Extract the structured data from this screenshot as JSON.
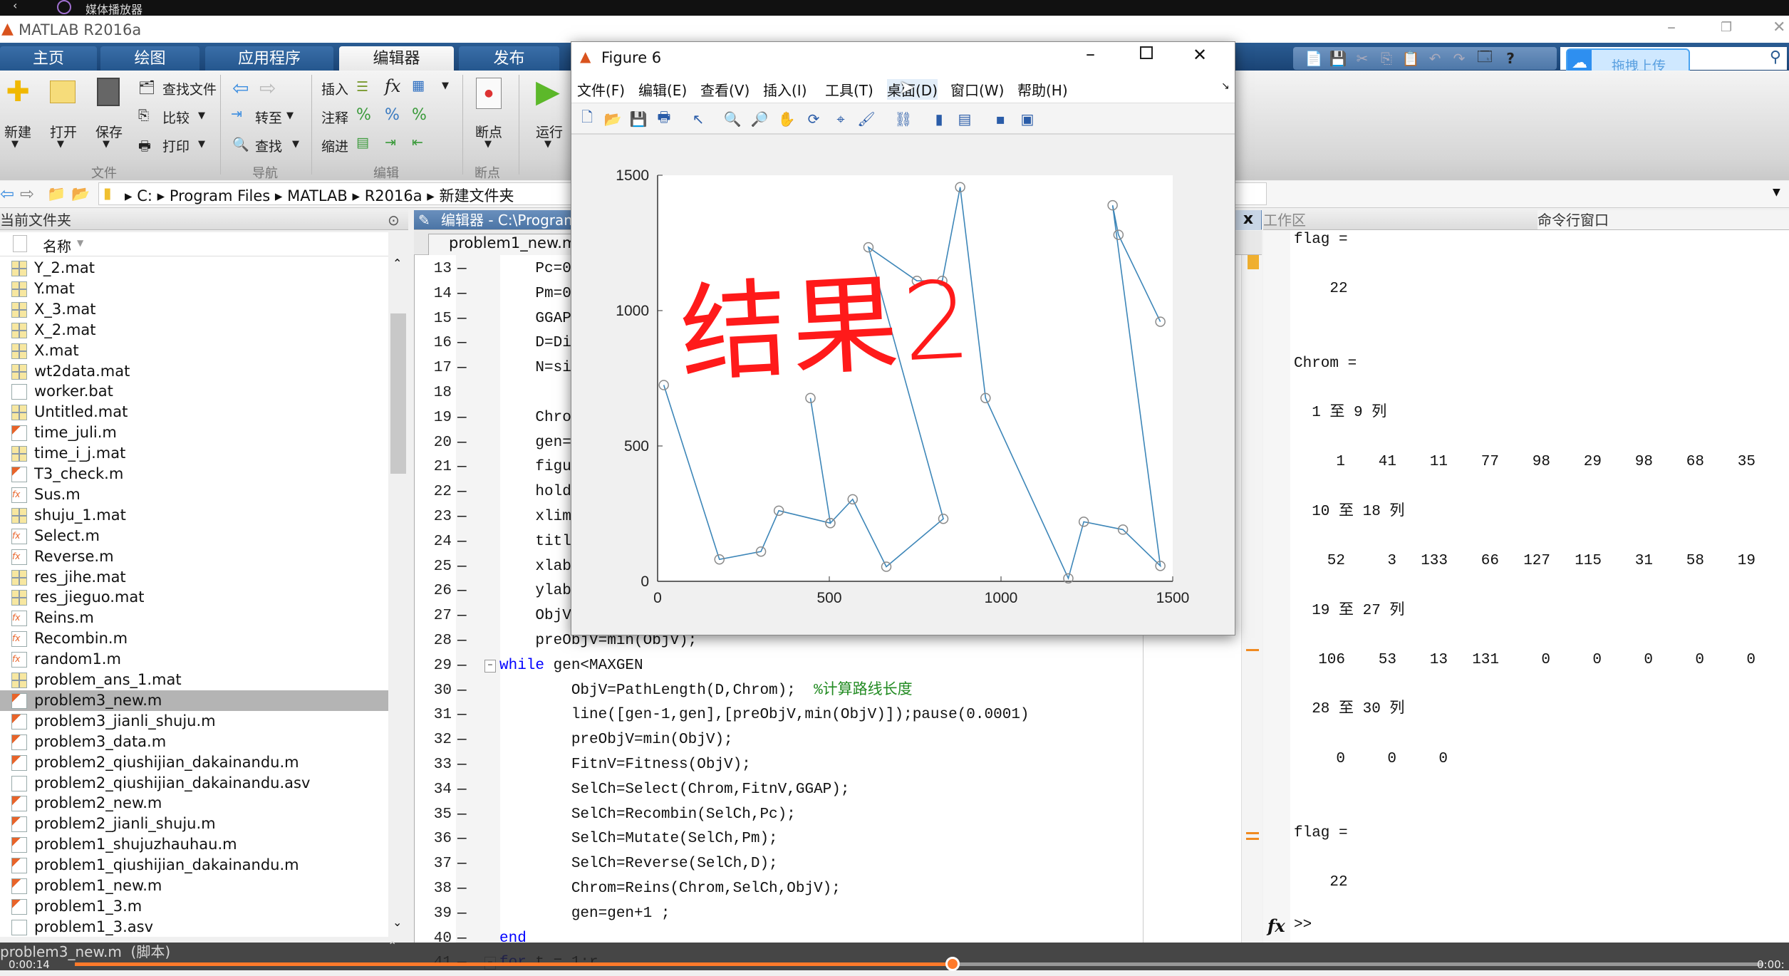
{
  "os": {
    "media_player": "媒体播放器",
    "elapsed": "0:00:14",
    "remaining": "0:00:",
    "progress_percent": 52
  },
  "app": {
    "title": "MATLAB R2016a"
  },
  "tabs": [
    {
      "label": "主页"
    },
    {
      "label": "绘图"
    },
    {
      "label": "应用程序"
    },
    {
      "label": "编辑器",
      "active": true
    },
    {
      "label": "发布"
    }
  ],
  "ribbon": {
    "new": "新建",
    "open": "打开",
    "save": "保存",
    "find_files": "查找文件",
    "compare": "比较",
    "print": "打印",
    "goto": "转至",
    "find": "查找",
    "insert": "插入",
    "comment": "注释",
    "indent": "缩进",
    "fx": "fx",
    "breakpoints": "断点",
    "run": "运行",
    "groups": {
      "file": "文件",
      "nav": "导航",
      "edit": "编辑",
      "bp": "断点"
    }
  },
  "quick_upload": "拖拽上传",
  "address": {
    "parts": [
      "C:",
      "Program Files",
      "MATLAB",
      "R2016a",
      "新建文件夹"
    ]
  },
  "current_folder": {
    "title": "当前文件夹",
    "col_name": "名称",
    "status": "problem3_new.m  (脚本)",
    "files": [
      {
        "name": "Y_2.mat",
        "type": "mat"
      },
      {
        "name": "Y.mat",
        "type": "mat"
      },
      {
        "name": "X_3.mat",
        "type": "mat"
      },
      {
        "name": "X_2.mat",
        "type": "mat"
      },
      {
        "name": "X.mat",
        "type": "mat"
      },
      {
        "name": "wt2data.mat",
        "type": "mat"
      },
      {
        "name": "worker.bat",
        "type": "bat"
      },
      {
        "name": "Untitled.mat",
        "type": "mat"
      },
      {
        "name": "time_juli.m",
        "type": "m"
      },
      {
        "name": "time_i_j.mat",
        "type": "mat"
      },
      {
        "name": "T3_check.m",
        "type": "m"
      },
      {
        "name": "Sus.m",
        "type": "fx"
      },
      {
        "name": "shuju_1.mat",
        "type": "mat"
      },
      {
        "name": "Select.m",
        "type": "fx"
      },
      {
        "name": "Reverse.m",
        "type": "fx"
      },
      {
        "name": "res_jihe.mat",
        "type": "mat"
      },
      {
        "name": "res_jieguo.mat",
        "type": "mat"
      },
      {
        "name": "Reins.m",
        "type": "fx"
      },
      {
        "name": "Recombin.m",
        "type": "fx"
      },
      {
        "name": "random1.m",
        "type": "fx"
      },
      {
        "name": "problem_ans_1.mat",
        "type": "mat"
      },
      {
        "name": "problem3_new.m",
        "type": "m",
        "selected": true
      },
      {
        "name": "problem3_jianli_shuju.m",
        "type": "m"
      },
      {
        "name": "problem3_data.m",
        "type": "m"
      },
      {
        "name": "problem2_qiushijian_dakainandu.m",
        "type": "m"
      },
      {
        "name": "problem2_qiushijian_dakainandu.asv",
        "type": "asv"
      },
      {
        "name": "problem2_new.m",
        "type": "m"
      },
      {
        "name": "problem2_jianli_shuju.m",
        "type": "m"
      },
      {
        "name": "problem1_shujuzhauhau.m",
        "type": "m"
      },
      {
        "name": "problem1_qiushijian_dakainandu.m",
        "type": "m"
      },
      {
        "name": "problem1_new.m",
        "type": "m"
      },
      {
        "name": "problem1_3.m",
        "type": "m"
      },
      {
        "name": "problem1_3.asv",
        "type": "asv"
      },
      {
        "name": "problem1_1.m",
        "type": "m"
      }
    ]
  },
  "editor": {
    "title": "编辑器 - C:\\Program",
    "tab": "problem1_new.m",
    "lines": [
      {
        "n": "13",
        "seg": [
          [
            "    Pc=0.9;",
            ""
          ]
        ]
      },
      {
        "n": "14",
        "seg": [
          [
            "    Pm=0.05;",
            ""
          ]
        ]
      },
      {
        "n": "15",
        "seg": [
          [
            "    GGAP=0.9",
            ""
          ]
        ]
      },
      {
        "n": "16",
        "seg": [
          [
            "    D=Distan",
            ""
          ]
        ]
      },
      {
        "n": "17",
        "seg": [
          [
            "    N=size(D,",
            ""
          ]
        ]
      },
      {
        "n": "18",
        "seg": [],
        "nodash": true
      },
      {
        "n": "19",
        "seg": [
          [
            "    Chrom=In",
            ""
          ]
        ]
      },
      {
        "n": "20",
        "seg": [
          [
            "    gen=0;",
            ""
          ]
        ]
      },
      {
        "n": "21",
        "seg": [
          [
            "    figure;",
            ""
          ]
        ]
      },
      {
        "n": "22",
        "seg": [
          [
            "    hold ",
            ""
          ],
          [
            "on",
            "str"
          ],
          [
            ";",
            ""
          ]
        ]
      },
      {
        "n": "23",
        "seg": [
          [
            "    xlim([0,",
            ""
          ]
        ]
      },
      {
        "n": "24",
        "seg": [
          [
            "    title(",
            ""
          ],
          [
            "'优",
            "str"
          ]
        ]
      },
      {
        "n": "25",
        "seg": [
          [
            "    xlabel(",
            ""
          ],
          [
            "'",
            "str"
          ]
        ]
      },
      {
        "n": "26",
        "seg": [
          [
            "    ylabel(",
            ""
          ],
          [
            "'",
            "str"
          ]
        ]
      },
      {
        "n": "27",
        "seg": [
          [
            "    ObjV=Pat",
            ""
          ]
        ]
      },
      {
        "n": "28",
        "seg": [
          [
            "    preObjV=min(ObjV);",
            ""
          ]
        ]
      },
      {
        "n": "29",
        "seg": [
          [
            "while",
            "kw"
          ],
          [
            " gen<MAXGEN",
            ""
          ]
        ],
        "fold": true
      },
      {
        "n": "30",
        "seg": [
          [
            "        ObjV=PathLength(D,Chrom);  ",
            ""
          ],
          [
            "%计算路线长度",
            "cmt"
          ]
        ]
      },
      {
        "n": "31",
        "seg": [
          [
            "        line([gen-1,gen],[preObjV,min(ObjV)]);pause(0.0001)",
            ""
          ]
        ]
      },
      {
        "n": "32",
        "seg": [
          [
            "        preObjV=min(ObjV);",
            ""
          ]
        ]
      },
      {
        "n": "33",
        "seg": [
          [
            "        FitnV=Fitness(ObjV);",
            ""
          ]
        ]
      },
      {
        "n": "34",
        "seg": [
          [
            "        SelCh=Select(Chrom,FitnV,GGAP);",
            ""
          ]
        ]
      },
      {
        "n": "35",
        "seg": [
          [
            "        SelCh=Recombin(SelCh,Pc);",
            ""
          ]
        ]
      },
      {
        "n": "36",
        "seg": [
          [
            "        SelCh=Mutate(SelCh,Pm);",
            ""
          ]
        ]
      },
      {
        "n": "37",
        "seg": [
          [
            "        SelCh=Reverse(SelCh,D);",
            ""
          ]
        ]
      },
      {
        "n": "38",
        "seg": [
          [
            "        Chrom=Reins(Chrom,SelCh,ObjV);",
            ""
          ]
        ]
      },
      {
        "n": "39",
        "seg": [
          [
            "        gen=gen+1 ;",
            ""
          ]
        ]
      },
      {
        "n": "40",
        "seg": [
          [
            "end",
            "kw"
          ]
        ]
      },
      {
        "n": "41",
        "seg": [
          [
            "for",
            "kw"
          ],
          [
            " t = 1:r",
            ""
          ]
        ],
        "fold": true
      }
    ]
  },
  "figure": {
    "title": "Figure 6",
    "menu": [
      "文件(F)",
      "编辑(E)",
      "查看(V)",
      "插入(I)",
      "工具(T)",
      "桌面(D)",
      "窗口(W)",
      "帮助(H)"
    ],
    "toolbar_icons": [
      "new-figure-icon",
      "open-icon",
      "save-icon",
      "print-icon",
      "pointer-icon",
      "zoom-in-icon",
      "zoom-out-icon",
      "pan-icon",
      "rotate-icon",
      "data-cursor-icon",
      "brush-icon",
      "link-icon",
      "colorbar-icon",
      "legend-icon",
      "hide-plot-tools-icon",
      "show-plot-tools-icon"
    ],
    "handwritten_annotation": "结果2",
    "annotation_color": "#ff1a1a"
  },
  "chart_data": {
    "type": "line",
    "markers": "circle",
    "line_color": "#3d86b8",
    "marker_color": "#8a8a8a",
    "xlim": [
      0,
      1500
    ],
    "ylim": [
      0,
      1500
    ],
    "xticks": [
      0,
      500,
      1000,
      1500
    ],
    "yticks": [
      0,
      500,
      1000,
      1500
    ],
    "grid": false,
    "x": [
      18,
      180,
      301,
      353,
      503,
      445,
      503,
      568,
      666,
      832,
      614,
      755,
      829,
      881,
      955,
      1196,
      1241,
      1355,
      1464,
      1325,
      1342,
      1464
    ],
    "y": [
      725,
      81,
      110,
      261,
      215,
      677,
      215,
      303,
      54,
      231,
      1234,
      1110,
      1110,
      1456,
      677,
      11,
      220,
      191,
      57,
      1389,
      1280,
      959
    ]
  },
  "panels": {
    "workspace": "工作区",
    "command": "命令行窗口"
  },
  "command": {
    "prompt": ">>",
    "lines": [
      {
        "t": "flag ="
      },
      {
        "t": ""
      },
      {
        "t": "    22"
      },
      {
        "t": ""
      },
      {
        "t": ""
      },
      {
        "t": "Chrom ="
      },
      {
        "t": ""
      },
      {
        "t": "  1 至 9 列"
      },
      {
        "t": ""
      },
      {
        "nums": [
          1,
          41,
          11,
          77,
          98,
          29,
          98,
          68,
          35
        ]
      },
      {
        "t": ""
      },
      {
        "t": "  10 至 18 列"
      },
      {
        "t": ""
      },
      {
        "nums": [
          52,
          3,
          133,
          66,
          127,
          115,
          31,
          58,
          19
        ]
      },
      {
        "t": ""
      },
      {
        "t": "  19 至 27 列"
      },
      {
        "t": ""
      },
      {
        "nums": [
          106,
          53,
          13,
          131,
          0,
          0,
          0,
          0,
          0
        ]
      },
      {
        "t": ""
      },
      {
        "t": "  28 至 30 列"
      },
      {
        "t": ""
      },
      {
        "nums": [
          0,
          0,
          0
        ]
      },
      {
        "t": ""
      },
      {
        "t": ""
      },
      {
        "t": "flag ="
      },
      {
        "t": ""
      },
      {
        "t": "    22"
      }
    ]
  }
}
